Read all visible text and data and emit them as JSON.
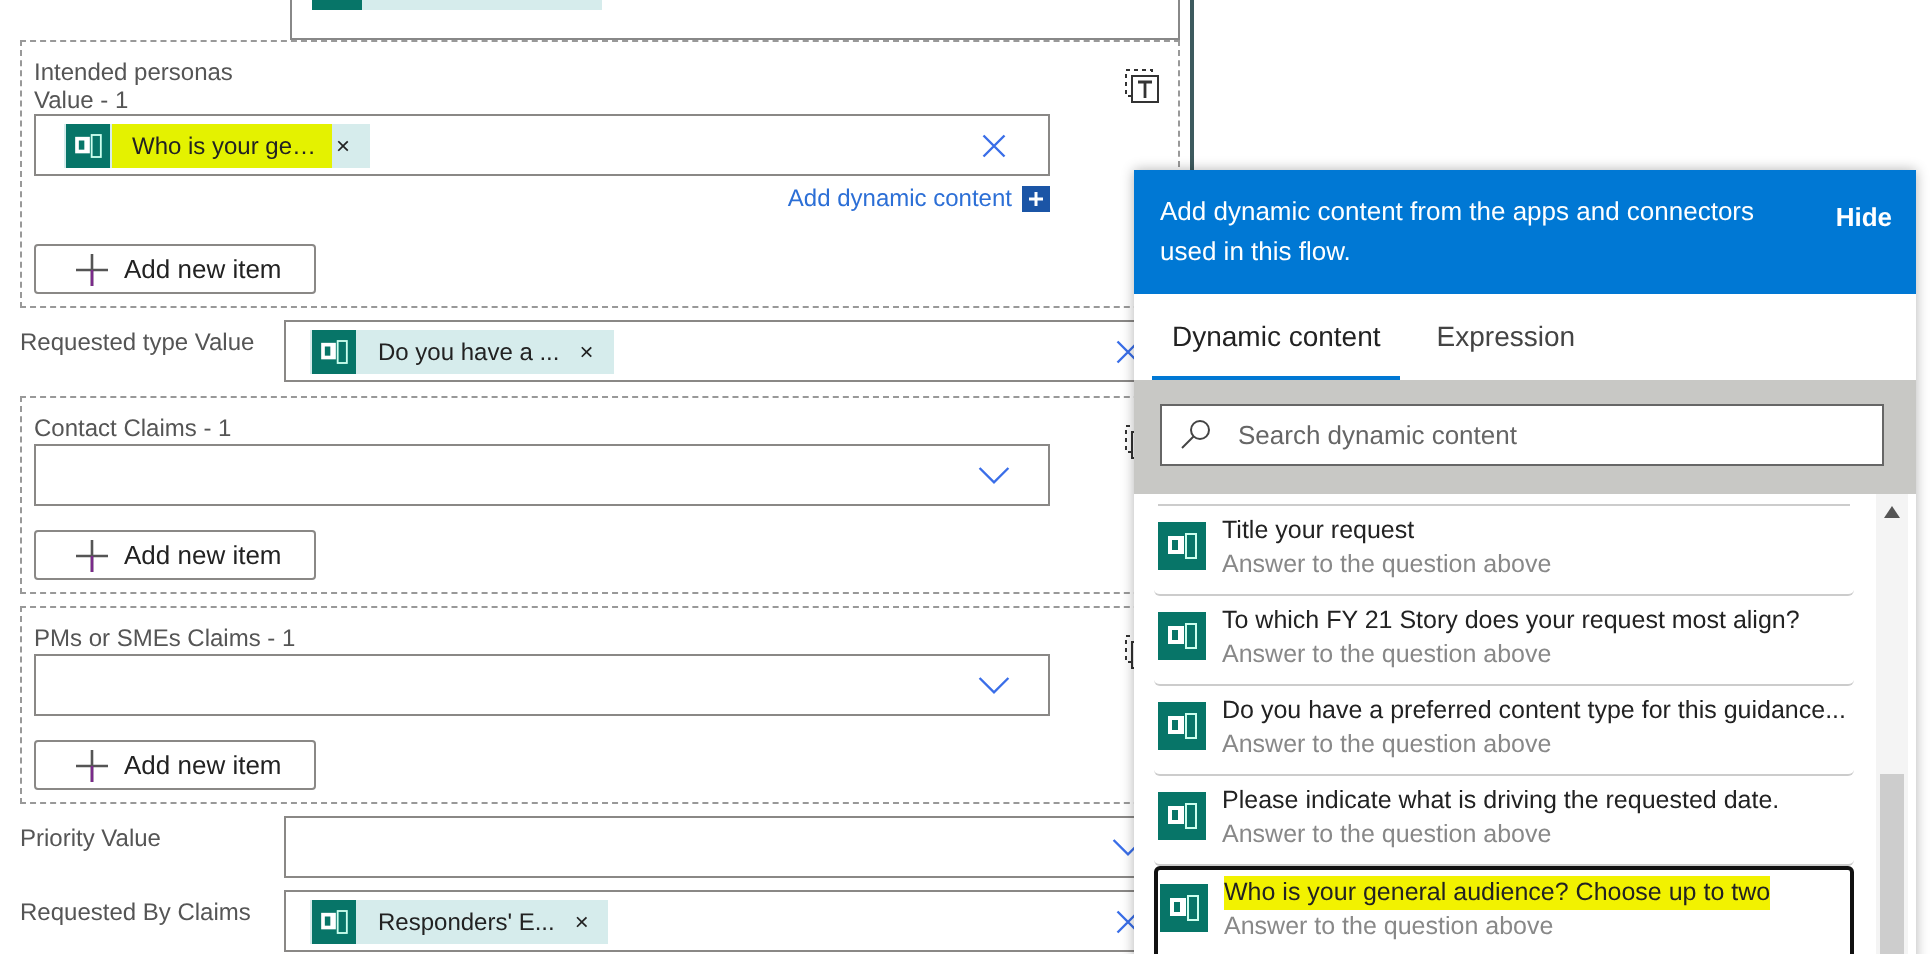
{
  "form": {
    "sections": [
      {
        "kind": "group",
        "label": "Intended personas",
        "sublabel": "Value - 1",
        "field": {
          "kind": "tokens",
          "tokens": [
            {
              "text": "Who is your ge…",
              "remove": "×",
              "highlighted": true
            }
          ]
        },
        "dynamic_link": "Add dynamic content",
        "add_button": "Add new item"
      },
      {
        "kind": "row",
        "label": "Requested type Value",
        "field": {
          "kind": "tokens",
          "tokens": [
            {
              "text": "Do you have a ...",
              "remove": "×",
              "highlighted": false
            }
          ]
        }
      },
      {
        "kind": "group",
        "label": "Contact Claims - 1",
        "field": {
          "kind": "dropdown"
        },
        "add_button": "Add new item"
      },
      {
        "kind": "group",
        "label": "PMs or SMEs Claims - 1",
        "field": {
          "kind": "dropdown"
        },
        "add_button": "Add new item"
      },
      {
        "kind": "row",
        "label": "Priority Value",
        "field": {
          "kind": "dropdown"
        }
      },
      {
        "kind": "row",
        "label": "Requested By Claims",
        "field": {
          "kind": "tokens",
          "tokens": [
            {
              "text": "Responders' E...",
              "remove": "×",
              "highlighted": false
            }
          ]
        }
      }
    ]
  },
  "dynamic_panel": {
    "message": "Add dynamic content from the apps and connectors used in this flow.",
    "hide_button": "Hide",
    "tabs": [
      {
        "label": "Dynamic content",
        "selected": true
      },
      {
        "label": "Expression",
        "selected": false
      }
    ],
    "search": {
      "placeholder": "Search dynamic content"
    },
    "items": [
      {
        "title": "Title your request",
        "subtitle": "Answer to the question above",
        "highlighted": false,
        "selected": false
      },
      {
        "title": "To which FY 21 Story does your request most align?",
        "subtitle": "Answer to the question above",
        "highlighted": false,
        "selected": false
      },
      {
        "title": "Do you have a preferred content type for this guidance...",
        "subtitle": "Answer to the question above",
        "highlighted": false,
        "selected": false
      },
      {
        "title": "Please indicate what is driving the requested date.",
        "subtitle": "Answer to the question above",
        "highlighted": false,
        "selected": false
      },
      {
        "title": "Who is your general audience? Choose up to two",
        "subtitle": "Answer to the question above",
        "highlighted": true,
        "selected": true
      }
    ]
  }
}
